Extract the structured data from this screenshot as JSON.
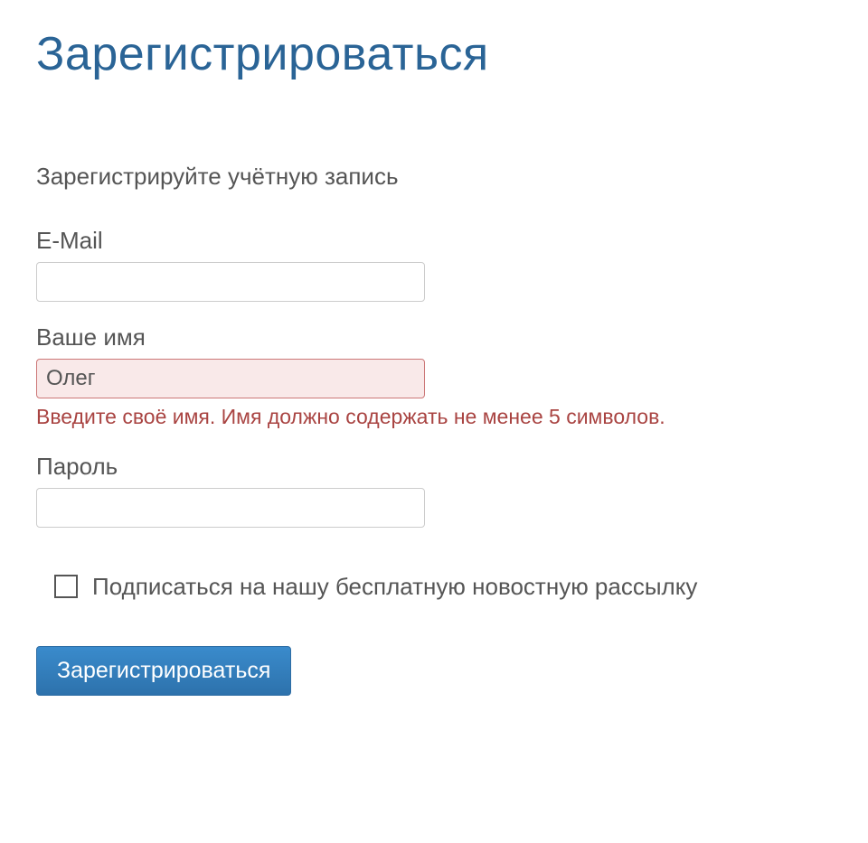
{
  "page": {
    "title": "Зарегистрироваться",
    "subtitle": "Зарегистрируйте учётную запись"
  },
  "form": {
    "email": {
      "label": "E-Mail",
      "value": ""
    },
    "name": {
      "label": "Ваше имя",
      "value": "Олег",
      "error": "Введите своё имя. Имя должно содержать не менее 5 символов."
    },
    "password": {
      "label": "Пароль",
      "value": ""
    },
    "newsletter": {
      "label": "Подписаться на нашу бесплатную новостную рассылку",
      "checked": false
    },
    "submit": {
      "label": "Зарегистрироваться"
    }
  }
}
